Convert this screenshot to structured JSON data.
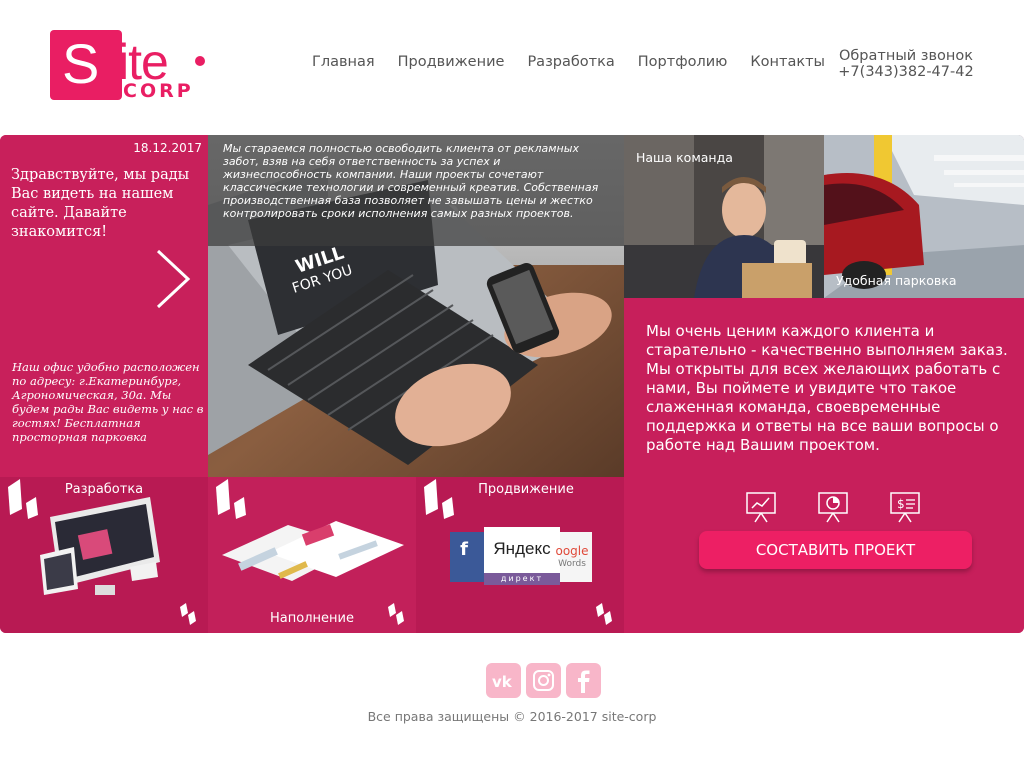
{
  "header": {
    "logo_S": "S",
    "logo_ite": "ite",
    "logo_corp": "CORP",
    "nav": [
      "Главная",
      "Продвижение",
      "Разработка",
      "Портфолию",
      "Контакты"
    ],
    "callback_label": "Обратный звонок",
    "callback_phone": "+7(343)382-47-42"
  },
  "left_panel": {
    "date": "18.12.2017",
    "greeting": "Здравствуйте, мы рады Вас видеть на нашем сайте. Давайте знакомится!",
    "office_text": "Наш офис удобно расположен по адресу: г.Екатеринбург, Агрономическая, 30а. Мы будем рады Вас видеть у нас в гостях! Бесплатная просторная парковка"
  },
  "photo_panel": {
    "overlay_text": "Мы стараемся полностью освободить клиента от рекламных забот, взяв на себя ответственность за успех и жизнеспособность компании. Наши проекты сочетают классические технологии и современный креатив. Собственная производственная база позволяет не завышать цены и жестко контролировать сроки исполнения самых разных проектов.",
    "screen_text": "FREE WILL FOR YOU"
  },
  "team_tile": {
    "caption": "Наша команда"
  },
  "parking_tile": {
    "caption": "Удобная парковка"
  },
  "right_panel": {
    "text": "Мы очень ценим каждого клиента и старательно - качественно выполняем заказ. Мы открыты для всех желающих работать с нами, Вы поймете и увидите что такое слаженная команда, своевременные поддержка и ответы на все ваши вопросы о работе над Вашим проектом.",
    "icons": [
      "presentation-chart-icon",
      "presentation-pie-icon",
      "presentation-dollar-icon"
    ],
    "cta_label": "СОСТАВИТЬ ПРОЕКТ"
  },
  "tiles": [
    {
      "title": "Разработка"
    },
    {
      "title": "Наполнение"
    },
    {
      "title": "Продвижение",
      "badge_left": "f",
      "badge_center": "Яндекс",
      "badge_center_sub": "директ",
      "badge_right": "oogle",
      "badge_right_sub": "Words"
    }
  ],
  "footer": {
    "social_icons": [
      "vk-icon",
      "instagram-icon",
      "facebook-icon"
    ],
    "copyright": "Все права защищены © 2016-2017 site-corp"
  },
  "colors": {
    "brand": "#e91e63",
    "panel": "#c8205b",
    "cta": "#ed1f64"
  }
}
